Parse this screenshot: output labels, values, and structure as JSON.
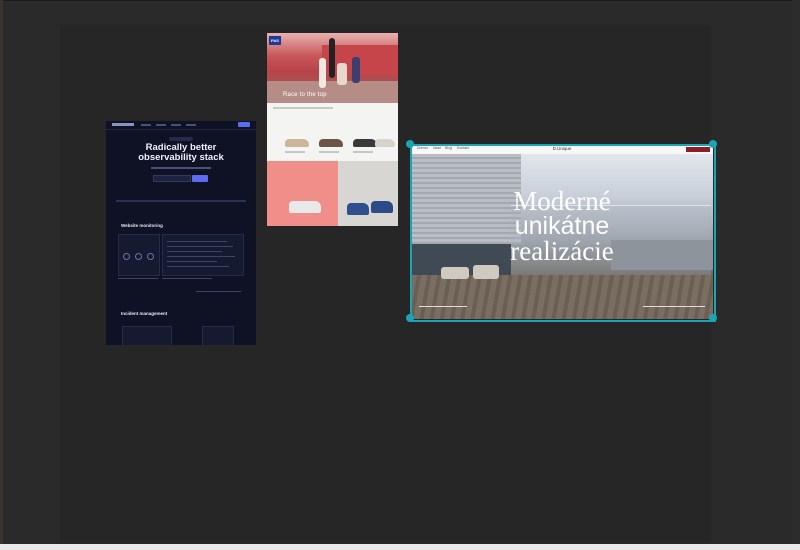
{
  "canvas": {
    "background": "#262626",
    "selection_color": "#1aa5b5"
  },
  "artboards": [
    {
      "id": "observability",
      "hero_line1": "Radically better",
      "hero_line2": "observability stack",
      "section1": "Website monitoring",
      "section2": "Incident management",
      "accent": "#5b6cf0"
    },
    {
      "id": "sneakers",
      "badge": "PAS",
      "tagline": "Race to the top"
    },
    {
      "id": "architecture",
      "brand": "D.Unique",
      "nav": [
        "Domov",
        "Nase",
        "Blog",
        "Kontakt"
      ],
      "headline_line1": "Moderné",
      "headline_line2": "unikátne",
      "headline_line3": "realizácie",
      "selected": true
    }
  ]
}
